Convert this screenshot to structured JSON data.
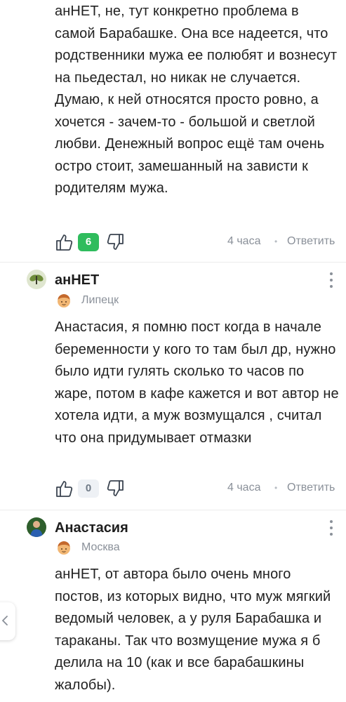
{
  "comments": [
    {
      "text": "анНЕТ, не, тут конкретно проблема в самой Барабашке. Она все надеется, что родственники мужа ее полюбят и вознесут на пьедестал, но никак не случается. Думаю, к ней относятся просто ровно, а хочется - зачем-то - большой и светлой любви. Денежный вопрос ещё там очень остро стоит, замешанный на зависти к родителям мужа.",
      "likes": "6",
      "time": "4 часа",
      "reply_label": "Ответить"
    },
    {
      "author": "анНЕТ",
      "city": "Липецк",
      "text": "Анастасия, я помню пост когда в начале беременности у кого то там был др, нужно было идти гулять сколько то часов по жаре, потом в кафе кажется и вот автор не хотела идти, а муж возмущался , считал что она придумывает отмазки",
      "likes": "0",
      "time": "4 часа",
      "reply_label": "Ответить"
    },
    {
      "author": "Анастасия",
      "city": "Москва",
      "text": "анНЕТ, от автора было очень много постов, из которых видно, что муж мягкий ведомый человек, а у руля Барабашка и тараканы. Так что возмущение мужа я б делила на 10 (как и все барабашкины жалобы)."
    }
  ],
  "icons": {
    "like": "thumbs-up-icon",
    "dislike": "thumbs-down-icon",
    "more": "more-vertical-icon",
    "city": "user-emoji-icon",
    "side": "chevron-left-icon"
  },
  "colors": {
    "accent_green": "#2fbc5d",
    "muted": "#8a9099"
  }
}
